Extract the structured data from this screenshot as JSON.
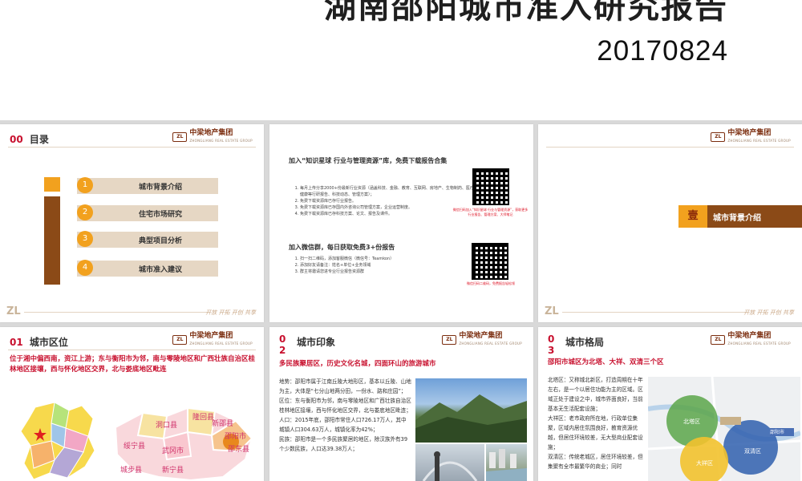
{
  "header": {
    "title": "湖南邵阳城市准入研究报告",
    "date": "20170824"
  },
  "brand": {
    "logo_mark": "ZL",
    "logo_name": "中梁地产集团",
    "logo_sub": "ZHONGLIANG REAL ESTATE GROUP",
    "footer_mark": "ZL",
    "footer_slogan": "开放 开拓 开创 共享",
    "colors": {
      "accent": "#c8102e",
      "orange": "#f2a11e",
      "brown": "#8b4a17",
      "beige": "#e6d7c4"
    }
  },
  "slide1": {
    "num": "00",
    "title": "目录",
    "items": [
      {
        "n": "1",
        "label": "城市背景介绍"
      },
      {
        "n": "2",
        "label": "住宅市场研究"
      },
      {
        "n": "3",
        "label": "典型项目分析"
      },
      {
        "n": "4",
        "label": "城市准入建议"
      }
    ]
  },
  "slide2": {
    "head1": "加入“知识星球 行业与管理资源”库，免费下载报告合集",
    "list1": [
      "每月上传分享2000+份最新行业资源（涵盖科技、金融、教育、互联网、房地产、生物制药、医疗健康等行研报告、科技动态、管理方案）；",
      "免费下载资源库已存行业报告。",
      "免费下载资源库已存国内外咨询公司管理方案，企业运营制度。",
      "免费下载资源库已存科技方案、论文、报告及课件。"
    ],
    "qr1_caption": "微信扫码加入“知识星球 行业与管理资源”，获取更多行业报告、管理方案、大师笔记",
    "head2": "加入微信群，每日获取免费3+份报告",
    "list2": [
      "扫一扫二维码，添加客服微信（微信号：Teamkon）",
      "添加好友请备注：姓名+单位+业务领域",
      "群主将邀请您进专业行业报告资源群"
    ],
    "qr2_caption": "微信扫码二维码，免费报告轻松领"
  },
  "slide3": {
    "badge": "壹",
    "label": "城市背景介绍"
  },
  "slide4": {
    "num": "01",
    "title": "城市区位",
    "headline": "位于湘中偏西南，资江上游；东与衡阳市为邻，南与零陵地区和广西壮族自治区桂林地区接壤，西与怀化地区交界，北与娄底地区毗连",
    "map_labels": [
      "洞口县",
      "隆回县",
      "新邵县",
      "绥宁县",
      "武冈市",
      "邵阳市",
      "邵东县",
      "城步县",
      "新宁县"
    ]
  },
  "slide5": {
    "num": "02",
    "title": "城市印象",
    "headline": "多民族聚居区，历史文化名城，四面环山的旅游城市",
    "paragraphs": [
      "地势：邵阳市属于江南丘陵大地形区，基本以丘陵、山地为主，大体是“七分山地两分田，一份水、路和庄园”；",
      "区位：东与衡阳市为邻，南与零陵地区和广西壮族自治区桂林地区接壤，西与怀化地区交界，北与娄底地区毗连；",
      "人口：2015年底，邵阳市常住人口726.17万人，其中城镇人口304.63万人，城镇化率为42%；",
      "民族：邵阳市是一个多民族聚居的地区，除汉族外有39个少数民族，人口达39.38万人；"
    ]
  },
  "slide6": {
    "num": "03",
    "title": "城市格局",
    "headline": "邵阳市城区为北塔、大祥、双清三个区",
    "paragraphs": [
      "北塔区：又称城北新区，打造周期在十年左右，是一个以居住功能为主的区域。区域正处于建设之中，城市界面良好，当前基本无生活配套设施；",
      "大祥区：老市政府所在地，行政单位集聚，区域内居住氛围良好，教育资源优越，但居住环境较差，无大型商业配套设施；",
      "双清区：传统老城区，居住环境较差，但集聚有全市最繁华的商业；同时"
    ],
    "map_labels": [
      "北塔区",
      "双清区",
      "大祥区",
      "邵阳市"
    ]
  }
}
